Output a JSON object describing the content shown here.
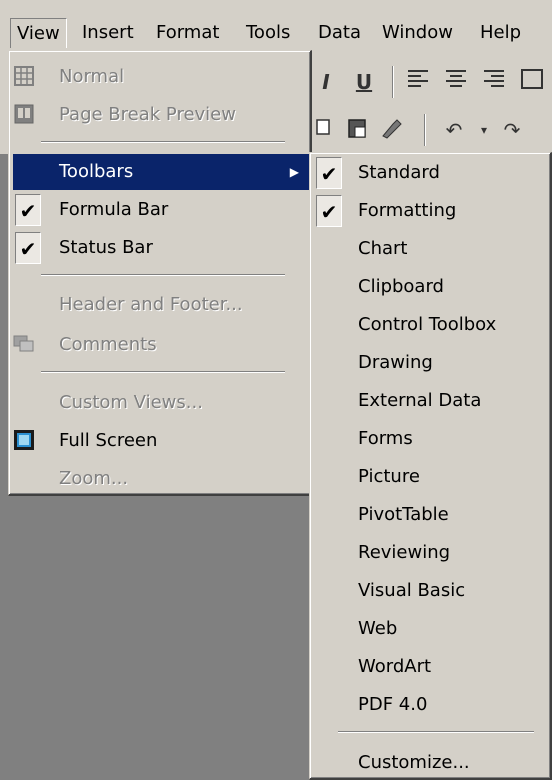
{
  "menubar": {
    "items": [
      "View",
      "Insert",
      "Format",
      "Tools",
      "Data",
      "Window",
      "Help"
    ]
  },
  "toolbar": {
    "row1": [
      "I",
      "U"
    ],
    "row2_undo": "↶",
    "row2_redo": "↷"
  },
  "view_menu": {
    "items": [
      {
        "label": "Normal",
        "disabled": true,
        "icon": "normal-view-icon"
      },
      {
        "label": "Page Break Preview",
        "disabled": true,
        "icon": "page-break-preview-icon"
      },
      {
        "label": "Toolbars",
        "highlighted": true,
        "submenu": true
      },
      {
        "label": "Formula Bar",
        "checked": true
      },
      {
        "label": "Status Bar",
        "checked": true
      },
      {
        "label": "Header and Footer...",
        "disabled": true
      },
      {
        "label": "Comments",
        "disabled": true,
        "icon": "comments-icon"
      },
      {
        "label": "Custom Views...",
        "disabled": true
      },
      {
        "label": "Full Screen",
        "icon": "full-screen-icon"
      },
      {
        "label": "Zoom...",
        "disabled": true
      }
    ]
  },
  "toolbars_menu": {
    "items": [
      {
        "label": "Standard",
        "checked": true
      },
      {
        "label": "Formatting",
        "checked": true
      },
      {
        "label": "Chart"
      },
      {
        "label": "Clipboard"
      },
      {
        "label": "Control Toolbox"
      },
      {
        "label": "Drawing"
      },
      {
        "label": "External Data"
      },
      {
        "label": "Forms"
      },
      {
        "label": "Picture"
      },
      {
        "label": "PivotTable"
      },
      {
        "label": "Reviewing"
      },
      {
        "label": "Visual Basic"
      },
      {
        "label": "Web"
      },
      {
        "label": "WordArt"
      },
      {
        "label": "PDF 4.0"
      },
      {
        "label": "Customize..."
      }
    ]
  },
  "colors": {
    "menu_face": "#d4d0c8",
    "highlight": "#0a246a",
    "workspace": "#808080",
    "disabled_text": "#808080"
  }
}
